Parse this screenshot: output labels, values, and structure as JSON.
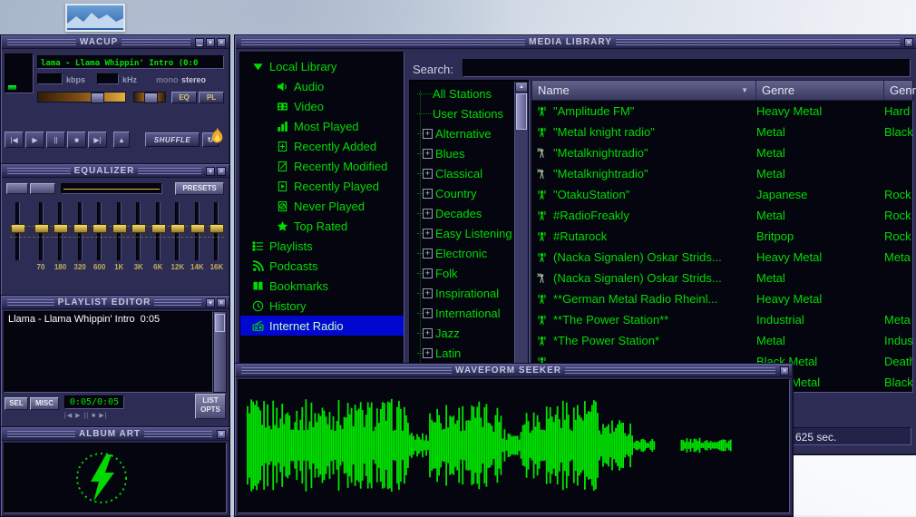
{
  "icons": {
    "minimize": "▁",
    "shade": "▾",
    "close": "✕"
  },
  "player": {
    "title": "WACUP",
    "marquee": "lama - Llama Whippin' Intro (0:0",
    "kbps_label": "kbps",
    "khz_label": "kHz",
    "mono_label": "mono",
    "stereo_label": "stereo",
    "eq_button": "EQ",
    "pl_button": "PL",
    "shuffle_button": "SHUFFLE",
    "repeat_glyph": "↻",
    "transport": [
      {
        "name": "previous",
        "glyph": "|◀"
      },
      {
        "name": "play",
        "glyph": "▶"
      },
      {
        "name": "pause",
        "glyph": "||"
      },
      {
        "name": "stop",
        "glyph": "■"
      },
      {
        "name": "next",
        "glyph": "▶|"
      },
      {
        "name": "eject",
        "glyph": "▲"
      }
    ]
  },
  "equalizer": {
    "title": "EQUALIZER",
    "presets_button": "PRESETS",
    "band_labels": [
      "70",
      "180",
      "320",
      "600",
      "1K",
      "3K",
      "6K",
      "12K",
      "14K",
      "16K"
    ]
  },
  "playlist": {
    "title": "PLAYLIST EDITOR",
    "items": [
      {
        "title": "Llama - Llama Whippin' Intro",
        "duration": "0:05"
      }
    ],
    "sel_button": "SEL",
    "misc_button": "MISC",
    "time_display": "0:05/0:05",
    "mini_transport": "|◀ ▶ || ■ ▶|",
    "list_opts_button": "LIST OPTS"
  },
  "album_art": {
    "title": "ALBUM ART"
  },
  "media_library": {
    "title": "MEDIA LIBRARY",
    "search_label": "Search:",
    "search_value": "",
    "scroll_up": "▲",
    "scroll_down": "▼",
    "status": "625 sec.",
    "tree": [
      {
        "label": "Local Library",
        "icon": "triangle-down-icon",
        "level": 0,
        "selected": false
      },
      {
        "label": "Audio",
        "icon": "speaker-icon",
        "level": 1,
        "selected": false
      },
      {
        "label": "Video",
        "icon": "film-icon",
        "level": 1,
        "selected": false
      },
      {
        "label": "Most Played",
        "icon": "chart-icon",
        "level": 1,
        "selected": false
      },
      {
        "label": "Recently Added",
        "icon": "doc-plus-icon",
        "level": 1,
        "selected": false
      },
      {
        "label": "Recently Modified",
        "icon": "doc-edit-icon",
        "level": 1,
        "selected": false
      },
      {
        "label": "Recently Played",
        "icon": "doc-play-icon",
        "level": 1,
        "selected": false
      },
      {
        "label": "Never Played",
        "icon": "doc-block-icon",
        "level": 1,
        "selected": false
      },
      {
        "label": "Top Rated",
        "icon": "star-icon",
        "level": 1,
        "selected": false
      },
      {
        "label": "Playlists",
        "icon": "list-icon",
        "level": 0,
        "selected": false
      },
      {
        "label": "Podcasts",
        "icon": "rss-icon",
        "level": 0,
        "selected": false
      },
      {
        "label": "Bookmarks",
        "icon": "book-icon",
        "level": 0,
        "selected": false
      },
      {
        "label": "History",
        "icon": "history-icon",
        "level": 0,
        "selected": false
      },
      {
        "label": "Internet Radio",
        "icon": "radio-icon",
        "level": 0,
        "selected": true
      }
    ],
    "stations": [
      {
        "label": "All Stations",
        "expandable": false
      },
      {
        "label": "User Stations",
        "expandable": false
      },
      {
        "label": "Alternative",
        "expandable": true
      },
      {
        "label": "Blues",
        "expandable": true
      },
      {
        "label": "Classical",
        "expandable": true
      },
      {
        "label": "Country",
        "expandable": true
      },
      {
        "label": "Decades",
        "expandable": true
      },
      {
        "label": "Easy Listening",
        "expandable": true
      },
      {
        "label": "Electronic",
        "expandable": true
      },
      {
        "label": "Folk",
        "expandable": true
      },
      {
        "label": "Inspirational",
        "expandable": true
      },
      {
        "label": "International",
        "expandable": true
      },
      {
        "label": "Jazz",
        "expandable": true
      },
      {
        "label": "Latin",
        "expandable": true
      }
    ],
    "table": {
      "columns": [
        "Name",
        "Genre",
        "Genre"
      ],
      "sort_glyph": "▼",
      "rows": [
        {
          "icon": "tower-icon",
          "name": "\"Amplitude FM\"",
          "genre": "Heavy Metal",
          "genre2": "Hard"
        },
        {
          "icon": "tower-icon",
          "name": "\"Metal knight radio\"",
          "genre": "Metal",
          "genre2": "Black"
        },
        {
          "icon": "tower-x-icon",
          "name": "\"Metalknightradio\"",
          "genre": "Metal",
          "genre2": ""
        },
        {
          "icon": "tower-x-icon",
          "name": "\"Metalknightradio\"",
          "genre": "Metal",
          "genre2": ""
        },
        {
          "icon": "tower-icon",
          "name": "\"OtakuStation\"",
          "genre": "Japanese",
          "genre2": "Rock"
        },
        {
          "icon": "tower-icon",
          "name": "#RadioFreakly",
          "genre": "Metal",
          "genre2": "Rock"
        },
        {
          "icon": "tower-icon",
          "name": "#Rutarock",
          "genre": "Britpop",
          "genre2": "Rock"
        },
        {
          "icon": "tower-icon",
          "name": "(Nacka Signalen) Oskar Strids...",
          "genre": "Heavy Metal",
          "genre2": "Meta"
        },
        {
          "icon": "tower-x-icon",
          "name": "(Nacka Signalen) Oskar Strids...",
          "genre": "Metal",
          "genre2": ""
        },
        {
          "icon": "tower-icon",
          "name": "**German Metal Radio Rheinl...",
          "genre": "Heavy Metal",
          "genre2": ""
        },
        {
          "icon": "tower-icon",
          "name": "**The Power Station**",
          "genre": "Industrial",
          "genre2": "Meta"
        },
        {
          "icon": "tower-icon",
          "name": "*The Power Station*",
          "genre": "Metal",
          "genre2": "Indus"
        },
        {
          "icon": "tower-icon",
          "name": "",
          "genre": "Black Metal",
          "genre2": "Death"
        },
        {
          "icon": "tower-icon",
          "name": "",
          "genre": "Death Metal",
          "genre2": "Black"
        }
      ]
    }
  },
  "waveform_seeker": {
    "title": "WAVEFORM SEEKER"
  }
}
